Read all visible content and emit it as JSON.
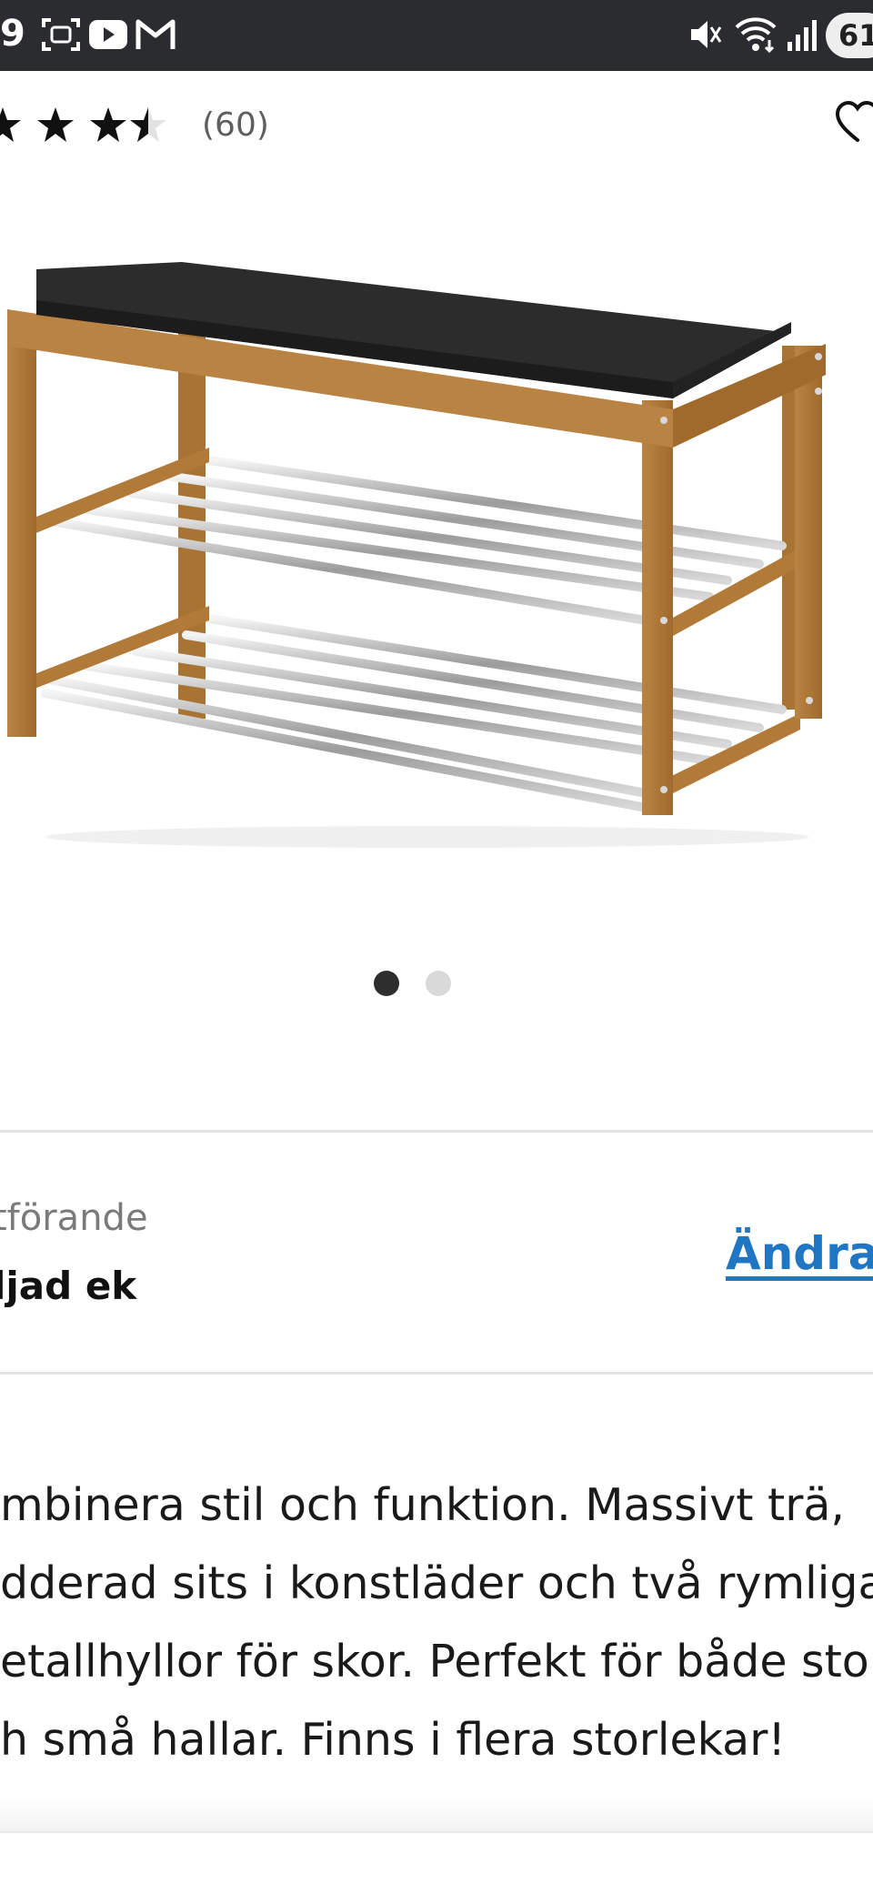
{
  "status_bar": {
    "time": "9",
    "battery": "61",
    "icons": [
      "screenshot-icon",
      "youtube-icon",
      "gmail-icon",
      "mute-icon",
      "wifi-icon",
      "signal-icon"
    ]
  },
  "rating": {
    "stars": 3.5,
    "count": "(60)"
  },
  "favorite_icon": "heart-icon",
  "carousel": {
    "current": 1,
    "total": 2
  },
  "variant": {
    "label": "tförande",
    "value": "ljad ek",
    "change_label": "Ändra"
  },
  "description": {
    "lines": [
      "mbinera stil och funktion. Massivt trä,",
      "dderad sits i konstläder och två rymliga",
      "etallhyllor för skor. Perfekt för både stora",
      "h små hallar. Finns i flera storlekar!"
    ]
  },
  "colors": {
    "status_bar": "#2b2c30",
    "link": "#1f76c2",
    "dot_active": "#2e2e2e",
    "dot_inactive": "#d9d9d9"
  }
}
